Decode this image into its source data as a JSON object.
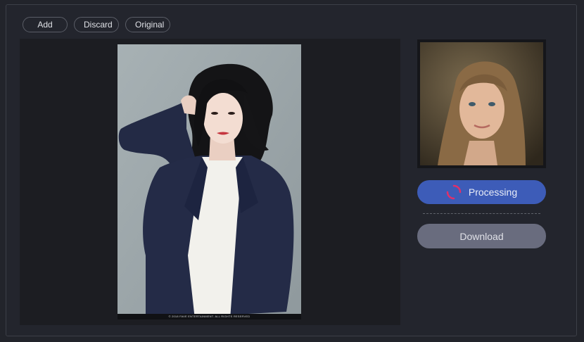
{
  "toolbar": {
    "add_label": "Add",
    "discard_label": "Discard",
    "original_label": "Original"
  },
  "workspace": {
    "photo_caption": "© 2018 FAVE ENTERTAINMENT. ALL RIGHTS RESERVED"
  },
  "actions": {
    "processing_label": "Processing",
    "download_label": "Download"
  },
  "colors": {
    "background": "#22242b",
    "canvas": "#1c1d22",
    "processing_button": "#3d5cb8",
    "spinner_accent": "#e0306a",
    "download_button": "#696c7e"
  },
  "icons": {
    "processing": "spinner-icon"
  }
}
